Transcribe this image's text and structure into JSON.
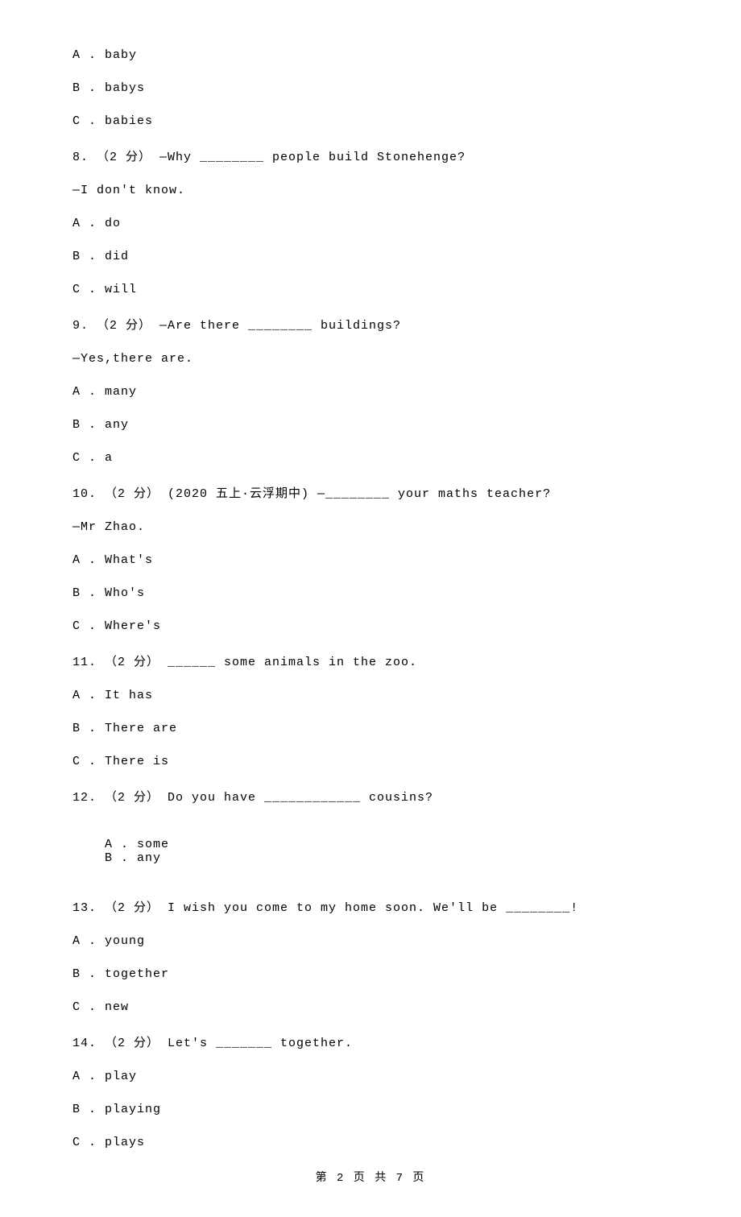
{
  "q7": {
    "optA": "A . baby",
    "optB": "B . babys",
    "optC": "C . babies"
  },
  "q8": {
    "stem": "8. （2 分） —Why ________ people build Stonehenge?",
    "line2": "—I don't know.",
    "optA": "A . do",
    "optB": "B . did",
    "optC": "C . will"
  },
  "q9": {
    "stem": "9. （2 分） —Are there ________ buildings?",
    "line2": "—Yes,there are.",
    "optA": "A . many",
    "optB": "B . any",
    "optC": "C . a"
  },
  "q10": {
    "stem": "10. （2 分） (2020 五上·云浮期中) —________ your maths teacher?",
    "line2": "—Mr Zhao.",
    "optA": "A . What's",
    "optB": "B . Who's",
    "optC": "C . Where's"
  },
  "q11": {
    "stem": "11. （2 分） ______ some animals in the zoo.",
    "optA": "A . It has",
    "optB": "B . There are",
    "optC": "C . There is"
  },
  "q12": {
    "stem": "12. （2 分） Do you have ____________ cousins?",
    "optA": "A . some",
    "optB": "B . any"
  },
  "q13": {
    "stem": "13. （2 分） I wish you come to my home soon. We'll be ________!",
    "optA": "A . young",
    "optB": "B . together",
    "optC": "C . new"
  },
  "q14": {
    "stem": "14. （2 分） Let's _______ together.",
    "optA": "A . play",
    "optB": "B . playing",
    "optC": "C . plays"
  },
  "footer": "第 2 页 共 7 页"
}
